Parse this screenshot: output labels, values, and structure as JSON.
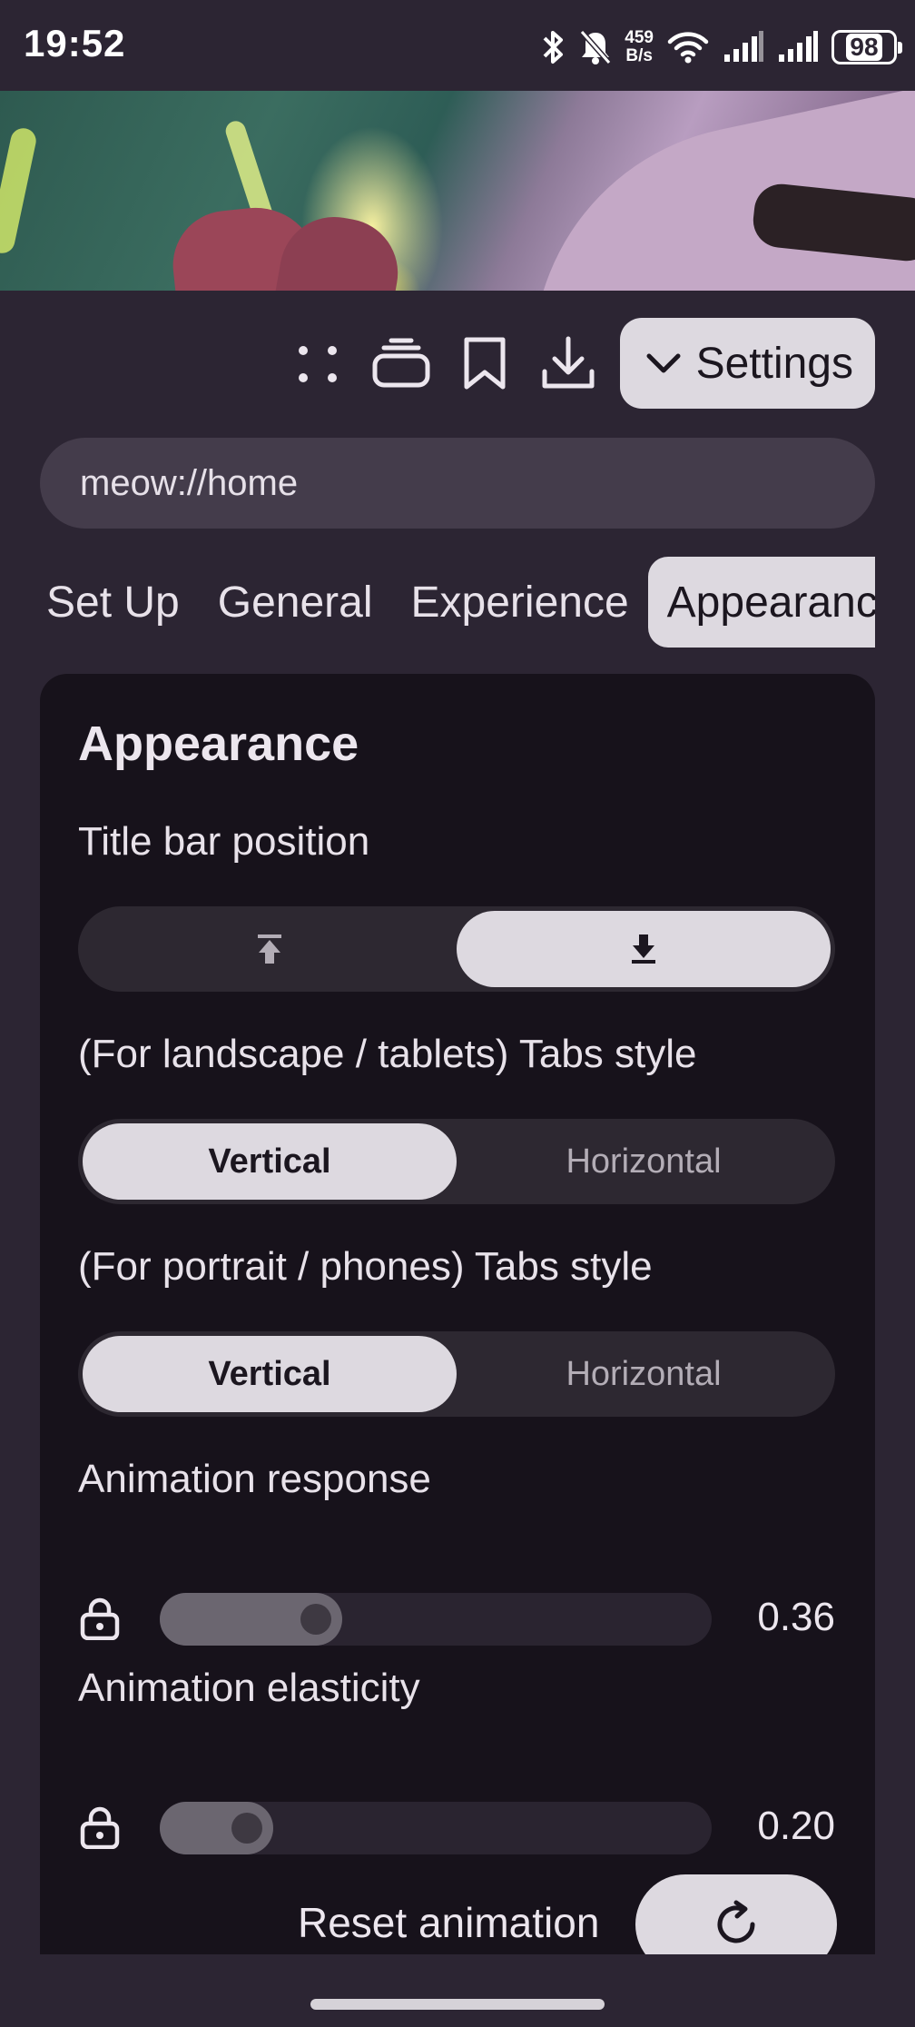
{
  "status_bar": {
    "time": "19:52",
    "net_speed_value": "459",
    "net_speed_unit": "B/s",
    "battery": "98"
  },
  "toolbar": {
    "settings_label": "Settings"
  },
  "url_bar": {
    "value": "meow://home"
  },
  "tabs": [
    {
      "label": "Set Up"
    },
    {
      "label": "General"
    },
    {
      "label": "Experience"
    },
    {
      "label": "Appearance",
      "active": true
    }
  ],
  "panel": {
    "title": "Appearance",
    "title_bar_position": {
      "label": "Title bar position",
      "selected": "bottom"
    },
    "landscape_tabs_style": {
      "label": "(For landscape / tablets) Tabs style",
      "options": [
        "Vertical",
        "Horizontal"
      ],
      "selected": "Vertical"
    },
    "portrait_tabs_style": {
      "label": "(For portrait / phones) Tabs style",
      "options": [
        "Vertical",
        "Horizontal"
      ],
      "selected": "Vertical"
    },
    "animation_response": {
      "label": "Animation response",
      "value": "0.36",
      "fraction": 0.36
    },
    "animation_elasticity": {
      "label": "Animation elasticity",
      "value": "0.20",
      "fraction": 0.2
    },
    "reset_animation": {
      "label": "Reset animation"
    }
  },
  "icons": {
    "toolbar": [
      "more-icon",
      "tabs-icon",
      "bookmark-icon",
      "download-icon",
      "chevron-down-icon"
    ],
    "status": [
      "bluetooth-icon",
      "mute-icon",
      "wifi-icon",
      "signal-icon",
      "battery-icon"
    ]
  }
}
